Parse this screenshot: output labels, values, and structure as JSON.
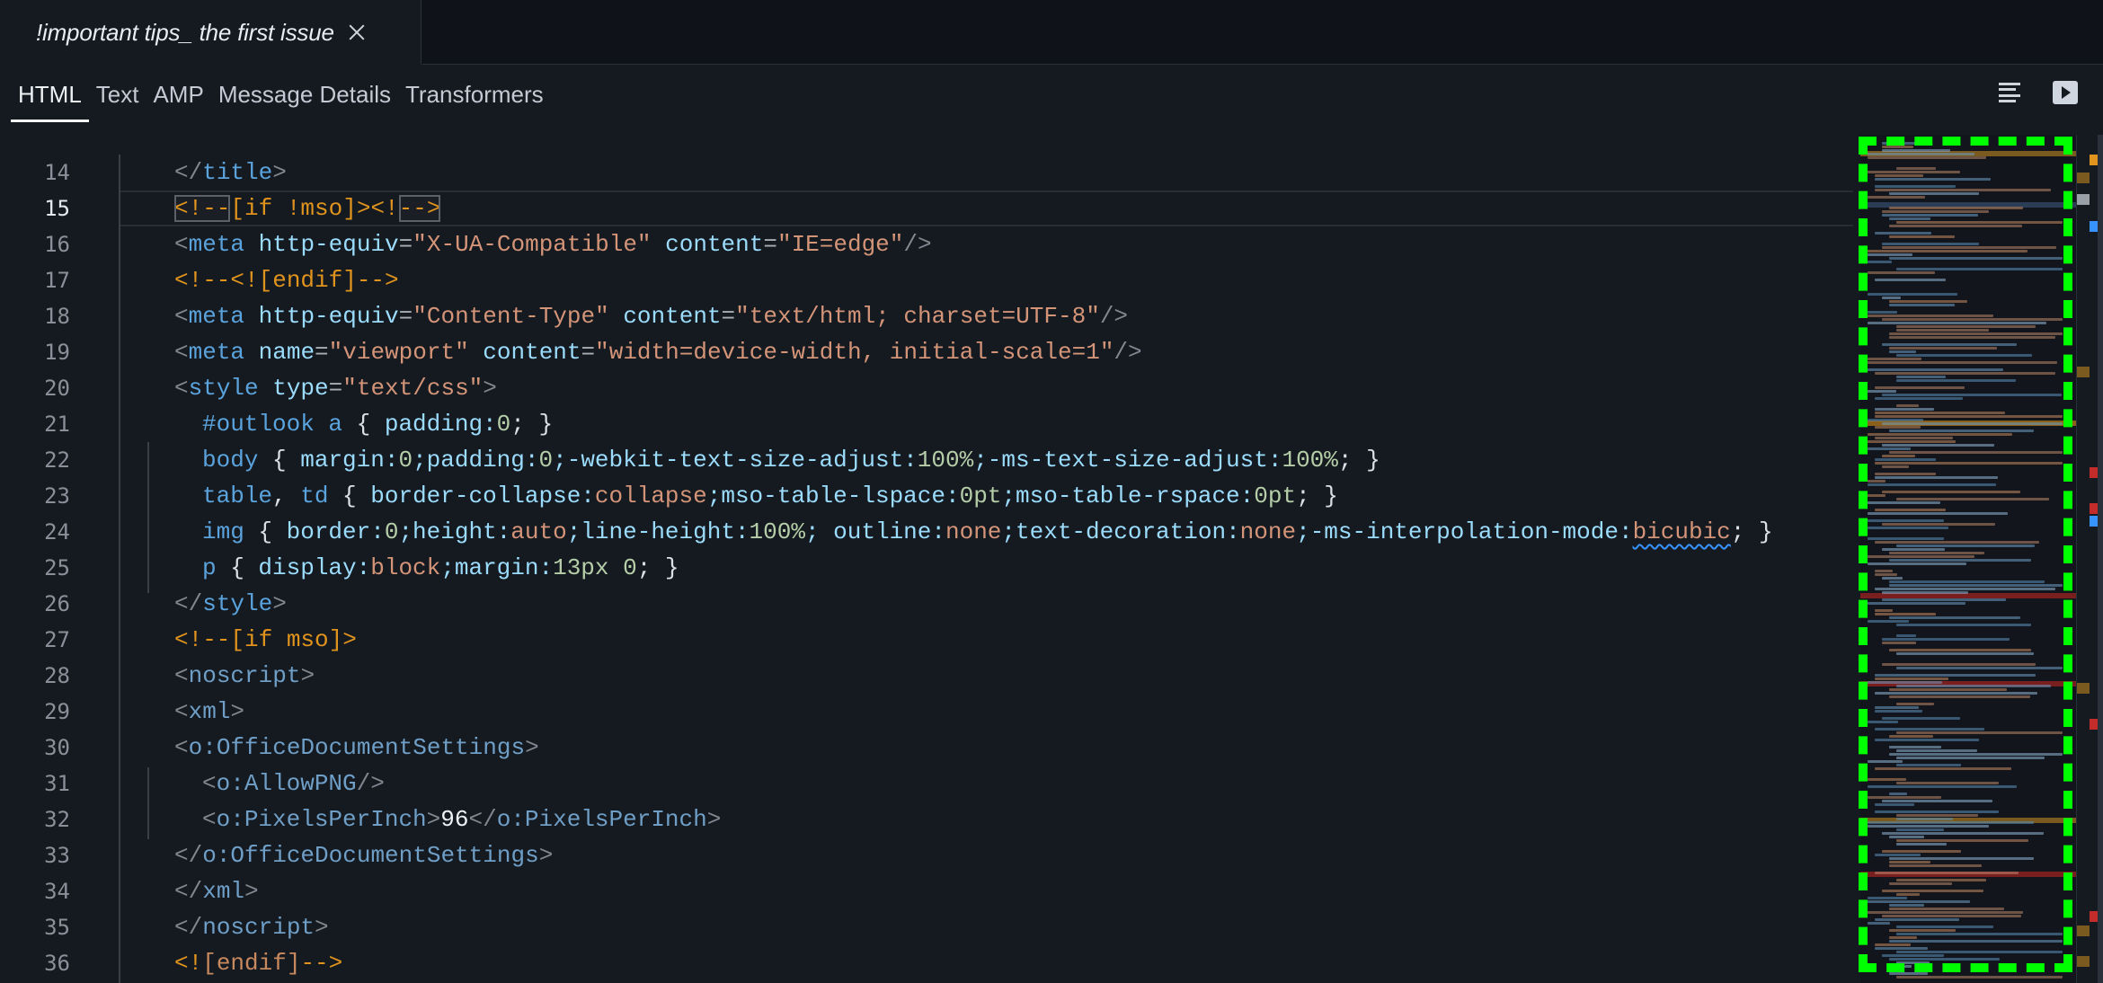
{
  "file_tab": {
    "title": "!important tips_ the first issue",
    "close_icon": "close-icon"
  },
  "view_tabs": [
    {
      "label": "HTML",
      "active": true
    },
    {
      "label": "Text",
      "active": false
    },
    {
      "label": "AMP",
      "active": false
    },
    {
      "label": "Message Details",
      "active": false
    },
    {
      "label": "Transformers",
      "active": false
    }
  ],
  "toolbar": {
    "format_icon": "format-lines-icon",
    "preview_icon": "play-preview-icon"
  },
  "editor": {
    "current_line": 15,
    "lines": [
      {
        "n": "14",
        "indent": 1,
        "tokens": [
          [
            "t-punct",
            "</"
          ],
          [
            "t-tag",
            "title"
          ],
          [
            "t-punct",
            ">"
          ]
        ]
      },
      {
        "n": "15",
        "indent": 1,
        "tokens": [
          [
            "t-cmt t-box",
            "<!--"
          ],
          [
            "t-cmt",
            "[if !mso]><!"
          ],
          [
            "t-cmt t-box",
            "-->"
          ]
        ]
      },
      {
        "n": "16",
        "indent": 1,
        "tokens": [
          [
            "t-punct",
            "<"
          ],
          [
            "t-tag",
            "meta"
          ],
          [
            "t-attr",
            " http-equiv"
          ],
          [
            "t-eq",
            "="
          ],
          [
            "t-str",
            "\"X-UA-Compatible\""
          ],
          [
            "t-attr",
            " content"
          ],
          [
            "t-eq",
            "="
          ],
          [
            "t-str",
            "\"IE=edge\""
          ],
          [
            "t-punct",
            "/>"
          ]
        ]
      },
      {
        "n": "17",
        "indent": 1,
        "tokens": [
          [
            "t-cmt",
            "<!--<![endif]-->"
          ]
        ]
      },
      {
        "n": "18",
        "indent": 1,
        "tokens": [
          [
            "t-punct",
            "<"
          ],
          [
            "t-tag",
            "meta"
          ],
          [
            "t-attr",
            " http-equiv"
          ],
          [
            "t-eq",
            "="
          ],
          [
            "t-str",
            "\"Content-Type\""
          ],
          [
            "t-attr",
            " content"
          ],
          [
            "t-eq",
            "="
          ],
          [
            "t-str",
            "\"text/html; charset=UTF-8\""
          ],
          [
            "t-punct",
            "/>"
          ]
        ]
      },
      {
        "n": "19",
        "indent": 1,
        "tokens": [
          [
            "t-punct",
            "<"
          ],
          [
            "t-tag",
            "meta"
          ],
          [
            "t-attr",
            " name"
          ],
          [
            "t-eq",
            "="
          ],
          [
            "t-str",
            "\"viewport\""
          ],
          [
            "t-attr",
            " content"
          ],
          [
            "t-eq",
            "="
          ],
          [
            "t-str",
            "\"width=device-width, initial-scale=1\""
          ],
          [
            "t-punct",
            "/>"
          ]
        ]
      },
      {
        "n": "20",
        "indent": 1,
        "tokens": [
          [
            "t-punct",
            "<"
          ],
          [
            "t-tag",
            "style"
          ],
          [
            "t-attr",
            " type"
          ],
          [
            "t-eq",
            "="
          ],
          [
            "t-str",
            "\"text/css\""
          ],
          [
            "t-punct",
            ">"
          ]
        ]
      },
      {
        "n": "21",
        "indent": 2,
        "tokens": [
          [
            "t-sel",
            "#outlook a"
          ],
          [
            "t-brace",
            " { "
          ],
          [
            "t-prop",
            "padding:"
          ],
          [
            "t-num",
            "0"
          ],
          [
            "t-brace",
            "; }"
          ]
        ]
      },
      {
        "n": "22",
        "indent": 2,
        "tokens": [
          [
            "t-sel",
            "body"
          ],
          [
            "t-brace",
            " { "
          ],
          [
            "t-prop",
            "margin:"
          ],
          [
            "t-num",
            "0"
          ],
          [
            "t-prop",
            ";padding:"
          ],
          [
            "t-num",
            "0"
          ],
          [
            "t-prop",
            ";-webkit-text-size-adjust:"
          ],
          [
            "t-num",
            "100%"
          ],
          [
            "t-prop",
            ";-ms-text-size-adjust:"
          ],
          [
            "t-num",
            "100%"
          ],
          [
            "t-brace",
            "; }"
          ]
        ]
      },
      {
        "n": "23",
        "indent": 2,
        "tokens": [
          [
            "t-sel",
            "table"
          ],
          [
            "t-brace",
            ", "
          ],
          [
            "t-sel",
            "td"
          ],
          [
            "t-brace",
            " { "
          ],
          [
            "t-prop",
            "border-collapse:"
          ],
          [
            "t-str",
            "collapse"
          ],
          [
            "t-prop",
            ";mso-table-lspace:"
          ],
          [
            "t-num",
            "0pt"
          ],
          [
            "t-prop",
            ";mso-table-rspace:"
          ],
          [
            "t-num",
            "0pt"
          ],
          [
            "t-brace",
            "; }"
          ]
        ]
      },
      {
        "n": "24",
        "indent": 2,
        "tokens": [
          [
            "t-sel",
            "img"
          ],
          [
            "t-brace",
            " { "
          ],
          [
            "t-prop",
            "border:"
          ],
          [
            "t-num",
            "0"
          ],
          [
            "t-prop",
            ";height:"
          ],
          [
            "t-str",
            "auto"
          ],
          [
            "t-prop",
            ";line-height:"
          ],
          [
            "t-num",
            "100%"
          ],
          [
            "t-prop",
            "; outline:"
          ],
          [
            "t-str",
            "none"
          ],
          [
            "t-prop",
            ";text-decoration:"
          ],
          [
            "t-str",
            "none"
          ],
          [
            "t-prop",
            ";-ms-interpolation-mode:"
          ],
          [
            "t-str t-squig",
            "bicubic"
          ],
          [
            "t-brace",
            "; }"
          ]
        ]
      },
      {
        "n": "25",
        "indent": 2,
        "tokens": [
          [
            "t-sel",
            "p"
          ],
          [
            "t-brace",
            " { "
          ],
          [
            "t-prop",
            "display:"
          ],
          [
            "t-str",
            "block"
          ],
          [
            "t-prop",
            ";margin:"
          ],
          [
            "t-num",
            "13px 0"
          ],
          [
            "t-brace",
            "; }"
          ]
        ]
      },
      {
        "n": "26",
        "indent": 1,
        "tokens": [
          [
            "t-punct",
            "</"
          ],
          [
            "t-tag",
            "style"
          ],
          [
            "t-punct",
            ">"
          ]
        ]
      },
      {
        "n": "27",
        "indent": 1,
        "tokens": [
          [
            "t-cmt",
            "<!--[if mso]>"
          ]
        ]
      },
      {
        "n": "28",
        "indent": 1,
        "tokens": [
          [
            "t-punct",
            "<"
          ],
          [
            "t-tagx",
            "noscript"
          ],
          [
            "t-punct",
            ">"
          ]
        ]
      },
      {
        "n": "29",
        "indent": 1,
        "tokens": [
          [
            "t-punct",
            "<"
          ],
          [
            "t-tagx",
            "xml"
          ],
          [
            "t-punct",
            ">"
          ]
        ]
      },
      {
        "n": "30",
        "indent": 1,
        "tokens": [
          [
            "t-punct",
            "<"
          ],
          [
            "t-tagx",
            "o:OfficeDocumentSettings"
          ],
          [
            "t-punct",
            ">"
          ]
        ]
      },
      {
        "n": "31",
        "indent": 2,
        "tokens": [
          [
            "t-punct",
            "<"
          ],
          [
            "t-tagx",
            "o:AllowPNG"
          ],
          [
            "t-punct",
            "/>"
          ]
        ]
      },
      {
        "n": "32",
        "indent": 2,
        "tokens": [
          [
            "t-punct",
            "<"
          ],
          [
            "t-tagx",
            "o:PixelsPerInch"
          ],
          [
            "t-punct",
            ">"
          ],
          [
            "t-text",
            "96"
          ],
          [
            "t-punct",
            "</"
          ],
          [
            "t-tagx",
            "o:PixelsPerInch"
          ],
          [
            "t-punct",
            ">"
          ]
        ]
      },
      {
        "n": "33",
        "indent": 1,
        "tokens": [
          [
            "t-punct",
            "</"
          ],
          [
            "t-tagx",
            "o:OfficeDocumentSettings"
          ],
          [
            "t-punct",
            ">"
          ]
        ]
      },
      {
        "n": "34",
        "indent": 1,
        "tokens": [
          [
            "t-punct",
            "</"
          ],
          [
            "t-tagx",
            "xml"
          ],
          [
            "t-punct",
            ">"
          ]
        ]
      },
      {
        "n": "35",
        "indent": 1,
        "tokens": [
          [
            "t-punct",
            "</"
          ],
          [
            "t-tagx",
            "noscript"
          ],
          [
            "t-punct",
            ">"
          ]
        ]
      },
      {
        "n": "36",
        "indent": 1,
        "tokens": [
          [
            "t-cmt",
            "<!"
          ],
          [
            "t-cmt2",
            "[endif]"
          ],
          [
            "t-cmt",
            "-->"
          ]
        ]
      }
    ]
  },
  "minimap": {
    "label": "minimap"
  },
  "overview_ruler": {
    "marks": [
      {
        "color": "#e0931d",
        "kind": "warning"
      },
      {
        "color": "#7a5a1e",
        "kind": "selection"
      },
      {
        "color": "#9aa0a8",
        "kind": "cursor"
      },
      {
        "color": "#3794ff",
        "kind": "info"
      },
      {
        "color": "#7a5a1e",
        "kind": "selection"
      },
      {
        "color": "#c42b2b",
        "kind": "error"
      },
      {
        "color": "#c42b2b",
        "kind": "error"
      },
      {
        "color": "#3794ff",
        "kind": "info"
      },
      {
        "color": "#7a5a1e",
        "kind": "selection"
      },
      {
        "color": "#c42b2b",
        "kind": "error"
      },
      {
        "color": "#c42b2b",
        "kind": "error"
      },
      {
        "color": "#7a5a1e",
        "kind": "selection"
      },
      {
        "color": "#7a5a1e",
        "kind": "selection"
      }
    ]
  }
}
